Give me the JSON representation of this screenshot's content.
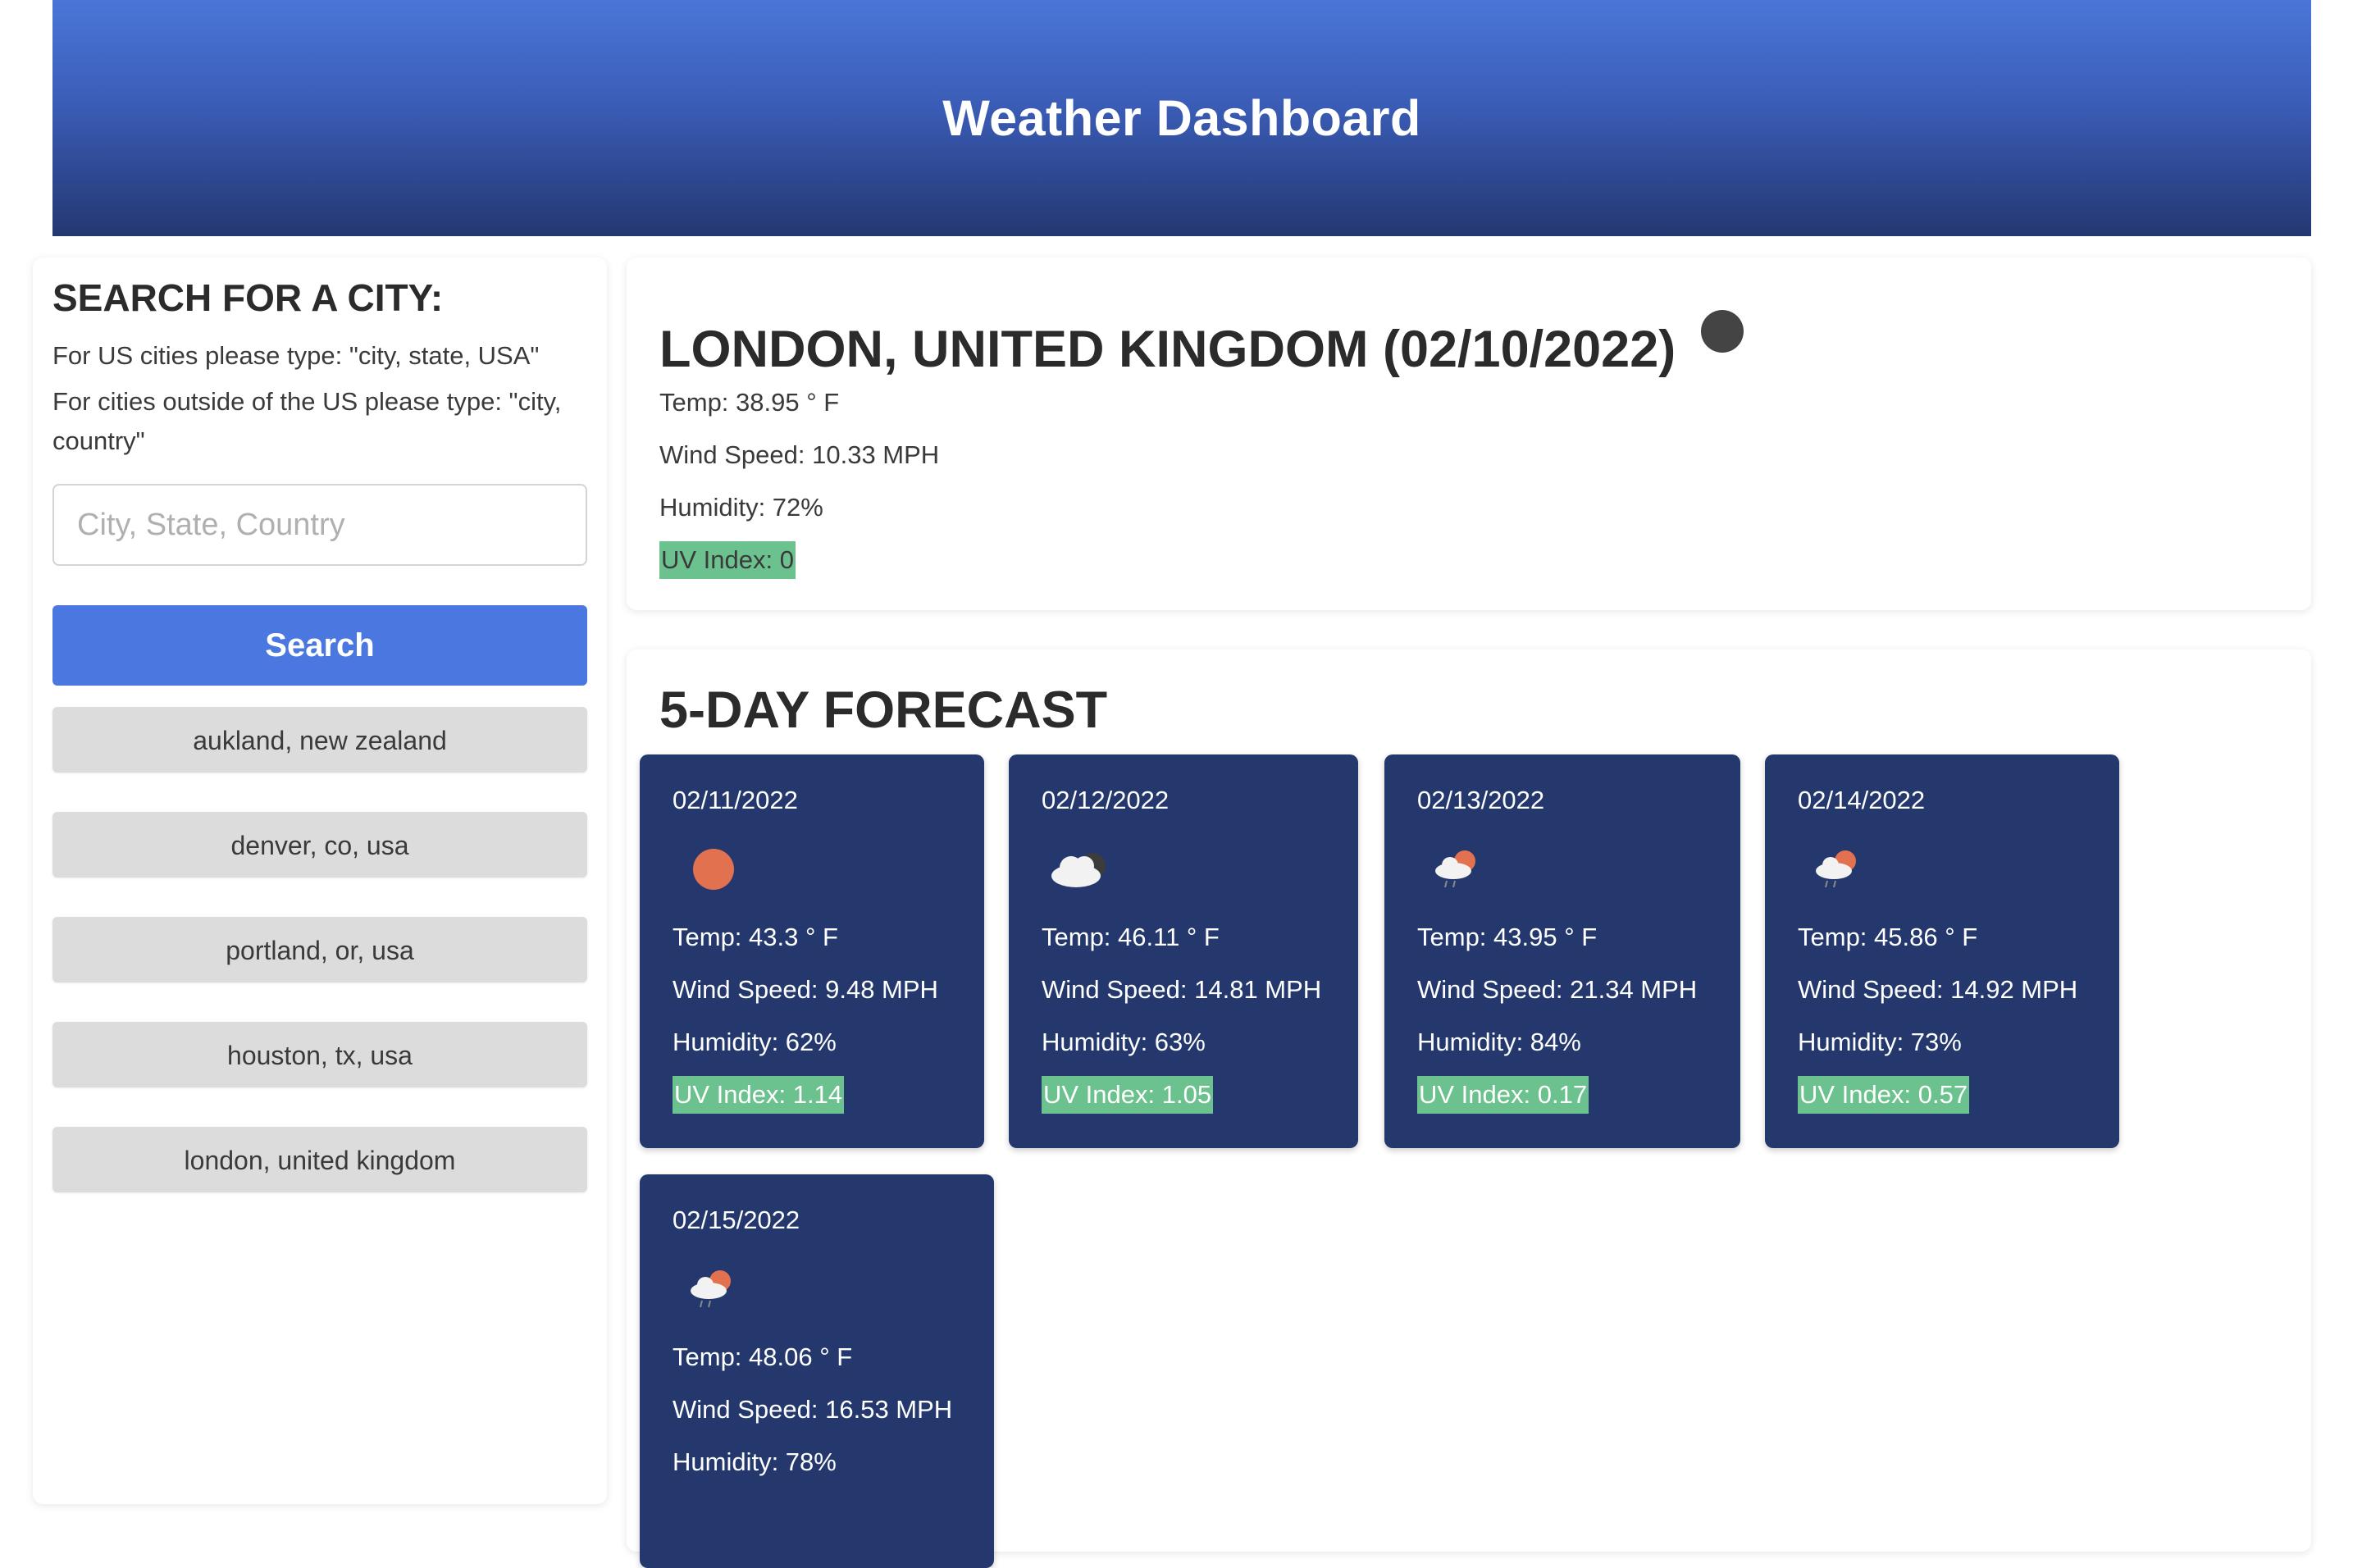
{
  "header": {
    "title": "Weather Dashboard"
  },
  "sidebar": {
    "heading": "SEARCH FOR A CITY:",
    "hint_us": "For US cities please type: \"city, state, USA\"",
    "hint_intl": "For cities outside of the US please type: \"city, country\"",
    "search_placeholder": "City, State, Country",
    "search_value": "",
    "search_label": "Search",
    "history": [
      "aukland, new zealand",
      "denver, co, usa",
      "portland, or, usa",
      "houston, tx, usa",
      "london, united kingdom"
    ]
  },
  "current": {
    "title": "LONDON, UNITED KINGDOM (02/10/2022)",
    "icon": "moon-icon",
    "temp": "Temp: 38.95 ° F",
    "wind": "Wind Speed: 10.33 MPH",
    "humidity": "Humidity: 72%",
    "uv": "UV Index: 0"
  },
  "forecast": {
    "title": "5-DAY FORECAST",
    "days": [
      {
        "date": "02/11/2022",
        "icon": "sun-icon",
        "temp": "Temp: 43.3 ° F",
        "wind": "Wind Speed: 9.48 MPH",
        "humidity": "Humidity: 62%",
        "uv": "UV Index: 1.14"
      },
      {
        "date": "02/12/2022",
        "icon": "cloudy-icon",
        "temp": "Temp: 46.11 ° F",
        "wind": "Wind Speed: 14.81 MPH",
        "humidity": "Humidity: 63%",
        "uv": "UV Index: 1.05"
      },
      {
        "date": "02/13/2022",
        "icon": "rain-sun-icon",
        "temp": "Temp: 43.95 ° F",
        "wind": "Wind Speed: 21.34 MPH",
        "humidity": "Humidity: 84%",
        "uv": "UV Index: 0.17"
      },
      {
        "date": "02/14/2022",
        "icon": "rain-sun-icon",
        "temp": "Temp: 45.86 ° F",
        "wind": "Wind Speed: 14.92 MPH",
        "humidity": "Humidity: 73%",
        "uv": "UV Index: 0.57"
      },
      {
        "date": "02/15/2022",
        "icon": "rain-sun-icon",
        "temp": "Temp: 48.06 ° F",
        "wind": "Wind Speed: 16.53 MPH",
        "humidity": "Humidity: 78%",
        "uv": ""
      }
    ]
  },
  "colors": {
    "header_top": "#4a76d8",
    "header_bottom": "#243771",
    "search_button": "#4b77e0",
    "forecast_card": "#24386e",
    "uv_highlight": "#6cc28e",
    "history_button": "#dcdcdc"
  }
}
